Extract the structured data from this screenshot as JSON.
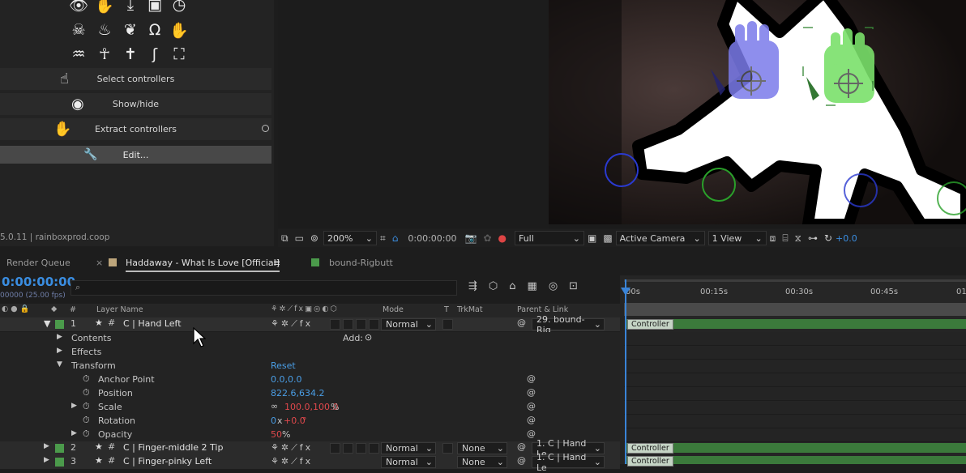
{
  "left_panel": {
    "buttons": {
      "select": "Select controllers",
      "showhide": "Show/hide",
      "extract": "Extract controllers",
      "edit": "Edit..."
    },
    "version": "5.0.11 | rainboxprod.coop"
  },
  "viewer_bar": {
    "zoom": "200%",
    "timecode": "0:00:00:00",
    "resolution": "Full",
    "camera": "Active Camera",
    "views": "1 View",
    "exposure": "+0.0"
  },
  "tabs": {
    "render_queue": "Render Queue",
    "comp": "Haddaway - What Is Love [Official]",
    "comp2": "bound-Rigbutt"
  },
  "timeline": {
    "timecode": "0:00:00:00",
    "fps": "00000 (25.00 fps)",
    "ruler": [
      "00s",
      "00:15s",
      "00:30s",
      "00:45s",
      "01"
    ],
    "columns": {
      "num": "#",
      "layer_name": "Layer Name",
      "mode": "Mode",
      "t": "T",
      "trkmat": "TrkMat",
      "parent": "Parent & Link"
    }
  },
  "layers": [
    {
      "num": "1",
      "name": "C | Hand Left",
      "mode": "Normal",
      "parent": "29. bound-Rig"
    },
    {
      "num": "2",
      "name": "C | Finger-middle 2 Tip",
      "mode": "Normal",
      "trkmat": "None",
      "parent": "1. C | Hand Le"
    },
    {
      "num": "3",
      "name": "C | Finger-pinky Left",
      "mode": "Normal",
      "trkmat": "None",
      "parent": "1. C | Hand Le"
    }
  ],
  "properties": {
    "contents": "Contents",
    "add": "Add:",
    "effects": "Effects",
    "transform": "Transform",
    "reset": "Reset",
    "anchor": {
      "label": "Anchor Point",
      "value": "0.0,0.0"
    },
    "position": {
      "label": "Position",
      "value": "822.6,634.2"
    },
    "scale": {
      "label": "Scale",
      "value": "100.0,100.0",
      "unit": "%"
    },
    "rotation": {
      "label": "Rotation",
      "value_x": "0",
      "x": "x",
      "value": "+0.0",
      "unit": "°"
    },
    "opacity": {
      "label": "Opacity",
      "value": "50",
      "unit": "%"
    }
  },
  "bar_label": "Controller",
  "colors": {
    "accent": "#3a8de0",
    "label_green": "#4b9a4b",
    "red_value": "#e0484c"
  }
}
